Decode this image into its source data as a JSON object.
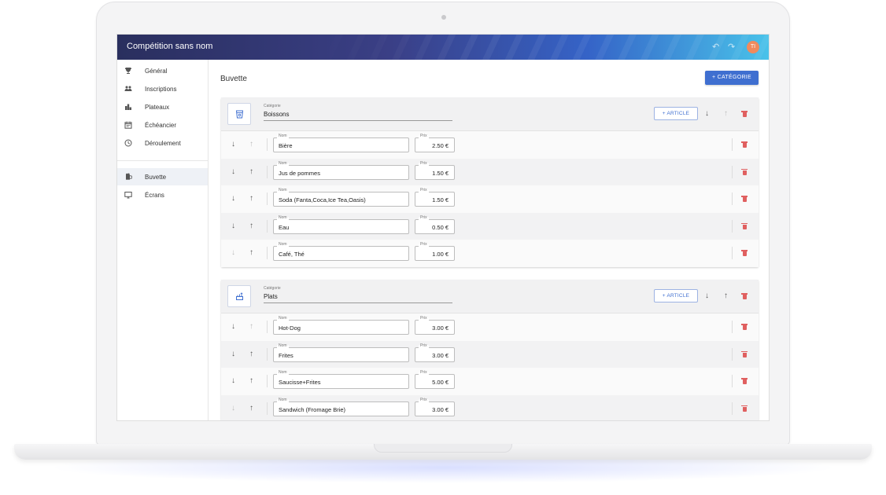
{
  "app": {
    "title": "Compétition sans nom",
    "avatar_initials": "TI",
    "accent_color": "#3f6fd0",
    "avatar_color": "#f08a5d",
    "delete_color": "#e06060"
  },
  "sidebar": {
    "items": [
      {
        "label": "Général",
        "icon": "trophy-icon"
      },
      {
        "label": "Inscriptions",
        "icon": "people-icon"
      },
      {
        "label": "Plateaux",
        "icon": "podium-icon"
      },
      {
        "label": "Échéancier",
        "icon": "calendar-icon"
      },
      {
        "label": "Déroulement",
        "icon": "clock-icon"
      },
      {
        "label": "Buvette",
        "icon": "bar-icon",
        "active": true
      },
      {
        "label": "Écrans",
        "icon": "monitor-icon"
      }
    ]
  },
  "page": {
    "title": "Buvette",
    "add_category_label": "+ CATÉGORIE"
  },
  "categories": [
    {
      "field_label": "Catégorie",
      "name": "Boissons",
      "icon": "cup-icon",
      "add_article_label": "+ ARTICLE",
      "items": [
        {
          "name_label": "Nom",
          "name": "Bière",
          "price_label": "Prix",
          "price": "2.50 €"
        },
        {
          "name_label": "Nom",
          "name": "Jus de pommes",
          "price_label": "Prix",
          "price": "1.50 €"
        },
        {
          "name_label": "Nom",
          "name": "Soda (Fanta,Coca,Ice Tea,Oasis)",
          "price_label": "Prix",
          "price": "1.50 €"
        },
        {
          "name_label": "Nom",
          "name": "Eau",
          "price_label": "Prix",
          "price": "0.50 €"
        },
        {
          "name_label": "Nom",
          "name": "Café, Thé",
          "price_label": "Prix",
          "price": "1.00 €"
        }
      ]
    },
    {
      "field_label": "Catégorie",
      "name": "Plats",
      "icon": "food-icon",
      "add_article_label": "+ ARTICLE",
      "items": [
        {
          "name_label": "Nom",
          "name": "Hot-Dog",
          "price_label": "Prix",
          "price": "3.00 €"
        },
        {
          "name_label": "Nom",
          "name": "Frites",
          "price_label": "Prix",
          "price": "3.00 €"
        },
        {
          "name_label": "Nom",
          "name": "Saucisse+Frites",
          "price_label": "Prix",
          "price": "5.00 €"
        },
        {
          "name_label": "Nom",
          "name": "Sandwich (Fromage Brie)",
          "price_label": "Prix",
          "price": "3.00 €"
        }
      ]
    }
  ]
}
